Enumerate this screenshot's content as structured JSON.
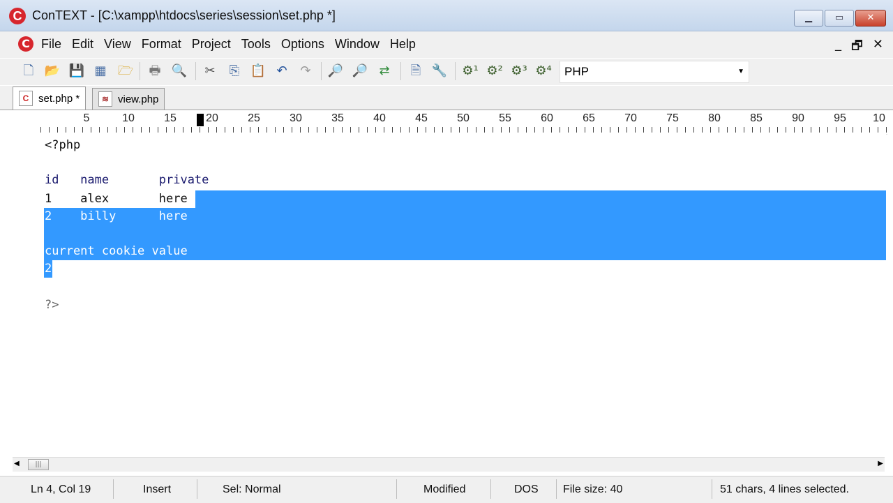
{
  "window": {
    "title": "ConTEXT - [C:\\xampp\\htdocs\\series\\session\\set.php *]",
    "logo_letter": "C"
  },
  "menu": {
    "items": [
      "File",
      "Edit",
      "View",
      "Format",
      "Project",
      "Tools",
      "Options",
      "Window",
      "Help"
    ],
    "mdi": [
      "_",
      "🗗",
      "✕"
    ]
  },
  "toolbar": {
    "language": "PHP"
  },
  "tabs": [
    {
      "label": "set.php *",
      "active": true,
      "icon": "php-file-icon"
    },
    {
      "label": "view.php",
      "active": false,
      "icon": "html-file-icon"
    }
  ],
  "ruler": {
    "numbers": [
      "5",
      "10",
      "15",
      "20",
      "25",
      "30",
      "35",
      "40",
      "45",
      "50",
      "55",
      "60",
      "65",
      "70",
      "75",
      "80",
      "85",
      "90",
      "95",
      "10"
    ]
  },
  "editor": {
    "lines": [
      {
        "text": "<?php"
      },
      {
        "text": ""
      },
      {
        "text": "id   name       private"
      },
      {
        "text": "1    alex       here"
      },
      {
        "text": "2    billy      here"
      },
      {
        "text": ""
      },
      {
        "text": "current cookie value"
      },
      {
        "text": "2"
      },
      {
        "text": ""
      },
      {
        "text": "?>"
      }
    ]
  },
  "status": {
    "position": "Ln 4, Col 19",
    "mode": "Insert",
    "selection_mode": "Sel: Normal",
    "modified": "Modified",
    "format": "DOS",
    "file_size": "File size: 40",
    "selection_info": "51 chars, 4 lines selected."
  },
  "colors": {
    "selection": "#3399ff",
    "accent": "#d7262d"
  }
}
